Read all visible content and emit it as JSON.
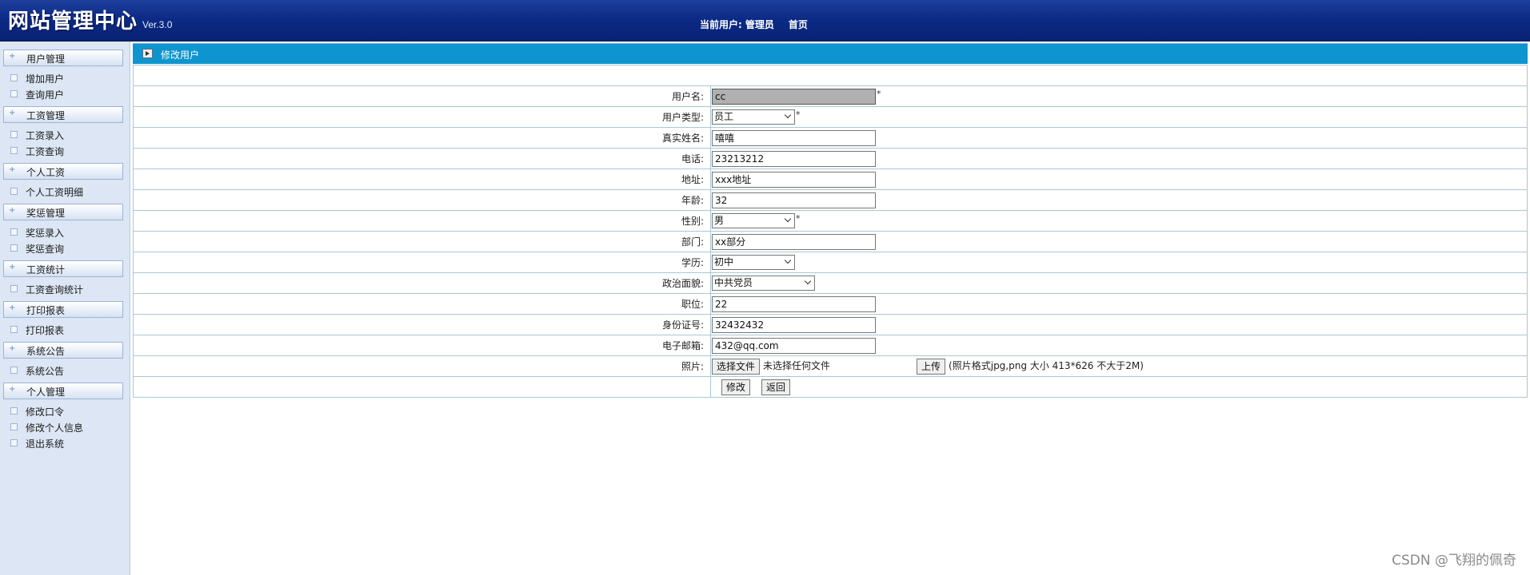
{
  "header": {
    "logo": "网站管理中心",
    "version": "Ver.3.0",
    "current_user_label": "当前用户:",
    "current_user": "管理员",
    "home_link": "首页"
  },
  "sidebar": {
    "groups": [
      {
        "title": "用户管理",
        "items": [
          "增加用户",
          "查询用户"
        ]
      },
      {
        "title": "工资管理",
        "items": [
          "工资录入",
          "工资查询"
        ]
      },
      {
        "title": "个人工资",
        "items": [
          "个人工资明细"
        ]
      },
      {
        "title": "奖惩管理",
        "items": [
          "奖惩录入",
          "奖惩查询"
        ]
      },
      {
        "title": "工资统计",
        "items": [
          "工资查询统计"
        ]
      },
      {
        "title": "打印报表",
        "items": [
          "打印报表"
        ]
      },
      {
        "title": "系统公告",
        "items": [
          "系统公告"
        ]
      },
      {
        "title": "个人管理",
        "items": [
          "修改口令",
          "修改个人信息",
          "退出系统"
        ]
      }
    ]
  },
  "panel": {
    "title": "修改用户"
  },
  "form": {
    "username": {
      "label": "用户名:",
      "value": "cc",
      "required_mark": "*"
    },
    "user_type": {
      "label": "用户类型:",
      "selected": "员工",
      "required_mark": "*"
    },
    "real_name": {
      "label": "真实姓名:",
      "value": "嘻嘻"
    },
    "phone": {
      "label": "电话:",
      "value": "23213212"
    },
    "address": {
      "label": "地址:",
      "value": "xxx地址"
    },
    "age": {
      "label": "年龄:",
      "value": "32"
    },
    "gender": {
      "label": "性别:",
      "selected": "男",
      "required_mark": "*"
    },
    "department": {
      "label": "部门:",
      "value": "xx部分"
    },
    "education": {
      "label": "学历:",
      "selected": "初中"
    },
    "political": {
      "label": "政治面貌:",
      "selected": "中共党员"
    },
    "position": {
      "label": "职位:",
      "value": "22"
    },
    "id_number": {
      "label": "身份证号:",
      "value": "32432432"
    },
    "email": {
      "label": "电子邮箱:",
      "value": "432@qq.com"
    },
    "photo": {
      "label": "照片:",
      "choose_file": "选择文件",
      "no_file": "未选择任何文件",
      "upload": "上传",
      "hint": "(照片格式jpg,png 大小 413*626 不大于2M)"
    },
    "submit_label": "修改",
    "back_label": "返回"
  },
  "watermark": "CSDN @飞翔的佩奇"
}
